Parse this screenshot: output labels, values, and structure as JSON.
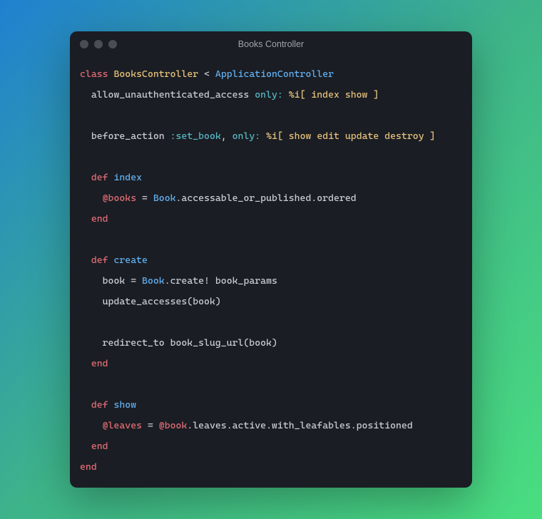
{
  "window": {
    "title": "Books Controller"
  },
  "code": {
    "class_kw": "class",
    "class_name": "BooksController",
    "inherit_op": "<",
    "parent_class": "ApplicationController",
    "allow_unauth": "allow_unauthenticated_access",
    "only1_key": "only:",
    "only1_val": "%i[ index show ]",
    "before_action": "before_action",
    "set_book_sym": ":set_book",
    "comma": ",",
    "only2_key": "only:",
    "only2_val": "%i[ show edit update destroy ]",
    "def_kw": "def",
    "end_kw": "end",
    "m_index": "index",
    "index_ivar": "@books",
    "eq": "=",
    "book_const": "Book",
    "index_chain": ".accessable_or_published.ordered",
    "m_create": "create",
    "create_lvar": "book",
    "create_call": ".create!",
    "create_arg": "book_params",
    "update_accesses": "update_accesses(book)",
    "redirect": "redirect_to book_slug_url(book)",
    "m_show": "show",
    "show_ivar": "@leaves",
    "show_rhs_ivar": "@book",
    "show_chain": ".leaves.active.with_leafables.positioned"
  }
}
